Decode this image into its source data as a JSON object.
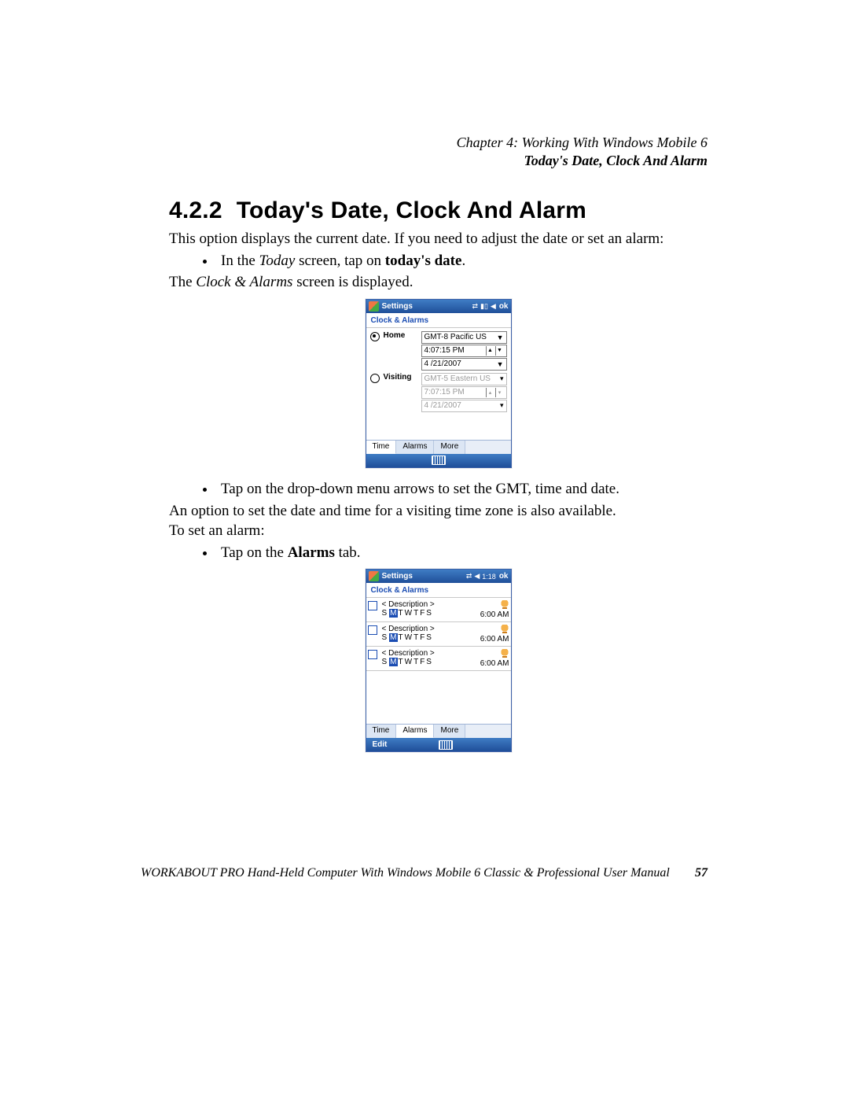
{
  "header": {
    "chapter_line": "Chapter  4:  Working With Windows Mobile 6",
    "section_line": "Today's Date, Clock And Alarm"
  },
  "section": {
    "number": "4.2.2",
    "title": "Today's Date, Clock And Alarm"
  },
  "para1": "This option displays the current date. If you need to adjust the date or set an alarm:",
  "bullet1_a": "In the ",
  "bullet1_b": "Today",
  "bullet1_c": " screen, tap on ",
  "bullet1_d": "today's date",
  "bullet1_e": ".",
  "para2_a": "The ",
  "para2_b": "Clock & Alarms",
  "para2_c": " screen is displayed.",
  "shot1": {
    "title": "Settings",
    "ok": "ok",
    "sub": "Clock & Alarms",
    "home_label": "Home",
    "visiting_label": "Visiting",
    "home": {
      "tz": "GMT-8 Pacific US",
      "time": "4:07:15 PM",
      "date": "4 /21/2007"
    },
    "visiting": {
      "tz": "GMT-5 Eastern US",
      "time": "7:07:15 PM",
      "date": "4 /21/2007"
    },
    "tabs": {
      "time": "Time",
      "alarms": "Alarms",
      "more": "More"
    }
  },
  "bullet2": "Tap on the drop-down menu arrows to set the GMT, time and date.",
  "para3": "An option to set the date and time for a visiting time zone is also available.",
  "para4": "To set an alarm:",
  "bullet3_a": "Tap on the ",
  "bullet3_b": "Alarms",
  "bullet3_c": " tab.",
  "shot2": {
    "title": "Settings",
    "status_time": "1:18",
    "ok": "ok",
    "sub": "Clock & Alarms",
    "desc": "< Description >",
    "days": [
      "S",
      "M",
      "T",
      "W",
      "T",
      "F",
      "S"
    ],
    "day_on_index": 1,
    "alarm_time": "6:00 AM",
    "tabs": {
      "time": "Time",
      "alarms": "Alarms",
      "more": "More"
    },
    "edit": "Edit"
  },
  "footer": {
    "title": "WORKABOUT PRO Hand-Held Computer With Windows Mobile 6 Classic & Professional User Manual",
    "page": "57"
  }
}
